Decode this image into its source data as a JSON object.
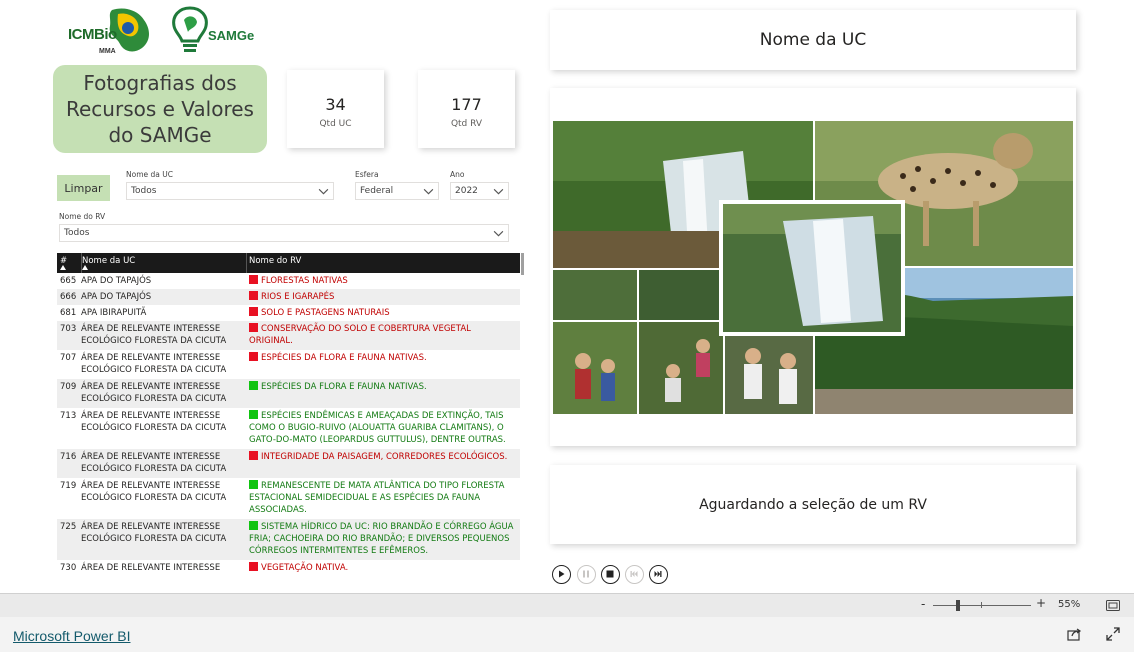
{
  "header": {
    "logo_icmbio": "ICMBio",
    "logo_icmbio_sub": "MMA",
    "logo_samge": "SAMGe",
    "title": "Fotografias dos\nRecursos e Valores\ndo SAMGe"
  },
  "kpis": [
    {
      "value": "34",
      "label": "Qtd UC"
    },
    {
      "value": "177",
      "label": "Qtd RV"
    }
  ],
  "filters": {
    "clear_label": "Limpar",
    "uc": {
      "label": "Nome da UC",
      "value": "Todos"
    },
    "esfera": {
      "label": "Esfera",
      "value": "Federal"
    },
    "ano": {
      "label": "Ano",
      "value": "2022"
    },
    "rv": {
      "label": "Nome do RV",
      "value": "Todos"
    }
  },
  "table": {
    "headers": [
      "#",
      "Nome da UC",
      "Nome do RV"
    ],
    "rows": [
      {
        "id": "665",
        "uc": "APA do Tapajós",
        "rv": "Florestas nativas",
        "status": "red"
      },
      {
        "id": "666",
        "uc": "APA do Tapajós",
        "rv": "Rios e igarapés",
        "status": "red"
      },
      {
        "id": "681",
        "uc": "APA Ibirapuitã",
        "rv": "Solo e pastagens naturais",
        "status": "red"
      },
      {
        "id": "703",
        "uc": "Área de Relevante Interesse Ecológico Floresta da Cicuta",
        "rv": "Conservação do solo e cobertura vegetal original.",
        "status": "red"
      },
      {
        "id": "707",
        "uc": "Área de Relevante Interesse Ecológico Floresta da Cicuta",
        "rv": "Espécies da flora e fauna nativas.",
        "status": "red"
      },
      {
        "id": "709",
        "uc": "Área de Relevante Interesse Ecológico Floresta da Cicuta",
        "rv": "Espécies da flora e fauna nativas.",
        "status": "green"
      },
      {
        "id": "713",
        "uc": "Área de Relevante Interesse Ecológico Floresta da Cicuta",
        "rv": "Espécies endêmicas e ameaçadas de extinção, tais como o bugio-ruivo (Alouatta guariba clamitans), o gato-do-mato (Leopardus guttulus), dentre outras.",
        "status": "green"
      },
      {
        "id": "716",
        "uc": "Área de Relevante Interesse Ecológico Floresta da Cicuta",
        "rv": "Integridade da paisagem, corredores ecológicos.",
        "status": "red"
      },
      {
        "id": "719",
        "uc": "Área de Relevante Interesse Ecológico Floresta da Cicuta",
        "rv": "Remanescente de Mata Atlântica do tipo Floresta Estacional Semidecidual e as espécies da fauna associadas.",
        "status": "green"
      },
      {
        "id": "725",
        "uc": "Área de Relevante Interesse Ecológico Floresta da Cicuta",
        "rv": "Sistema hídrico da UC: Rio Brandão e Córrego Água Fria; Cachoeira do Rio Brandão; e diversos pequenos córregos intermitentes e efêmeros.",
        "status": "green"
      },
      {
        "id": "730",
        "uc": "Área de Relevante Interesse",
        "rv": "Vegetação nativa.",
        "status": "red"
      }
    ]
  },
  "right": {
    "uc_title": "Nome da UC",
    "waiting_text": "Aguardando a seleção de um RV"
  },
  "footer": {
    "zoom": "55%",
    "zoom_level": 0.55,
    "powerbi_link": "Microsoft Power BI"
  },
  "icons": [
    "play-icon",
    "pause-icon",
    "stop-icon",
    "previous-icon",
    "next-icon",
    "chevron-down-icon",
    "fit-page-icon",
    "share-icon",
    "expand-icon"
  ],
  "colors": {
    "accent_green": "#c5e0b4",
    "status_red": "#e81123",
    "status_green": "#11c411",
    "header_black": "#1a1a1a"
  }
}
